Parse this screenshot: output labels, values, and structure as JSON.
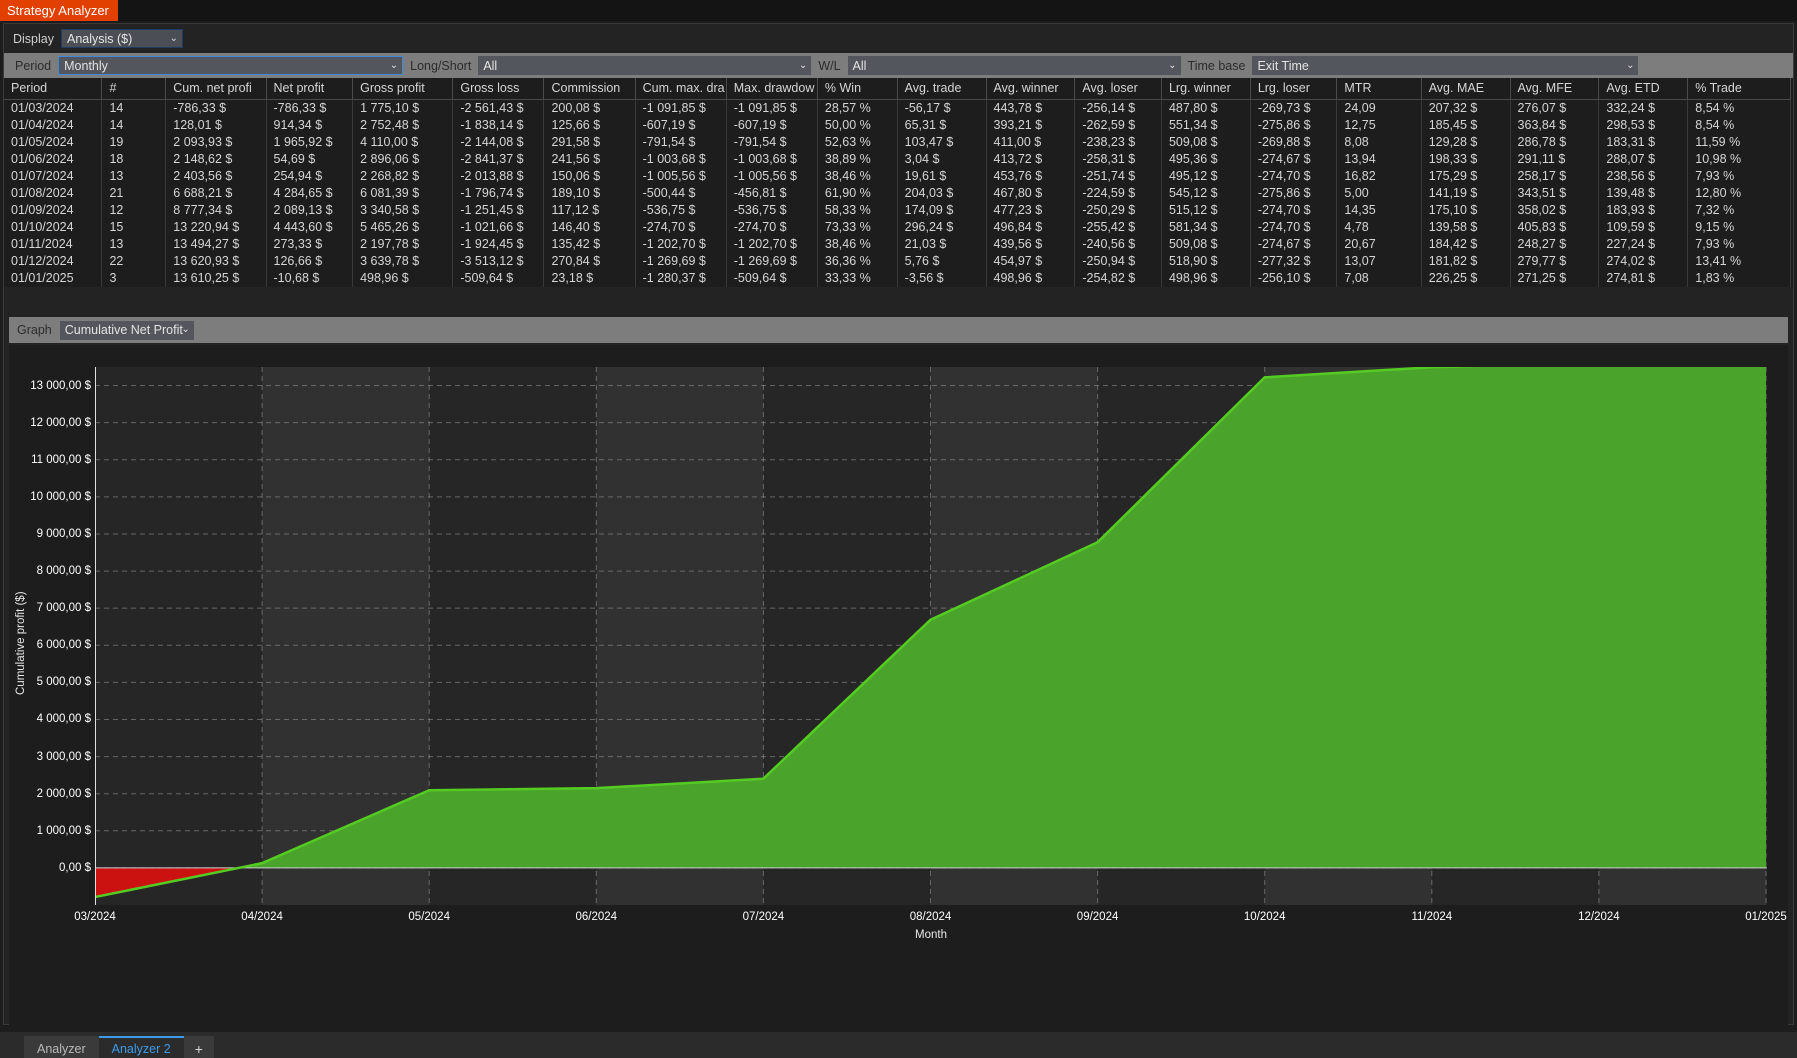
{
  "window": {
    "title": "Strategy Analyzer"
  },
  "toolbar": {
    "display_label": "Display",
    "display_value": "Analysis ($)",
    "period_label": "Period",
    "period_value": "Monthly",
    "longshort_label": "Long/Short",
    "longshort_value": "All",
    "wl_label": "W/L",
    "wl_value": "All",
    "timebase_label": "Time base",
    "timebase_value": "Exit Time",
    "caret": "⌄"
  },
  "graph_bar": {
    "label": "Graph",
    "value": "Cumulative Net Profit",
    "caret": "⌄"
  },
  "table": {
    "columns": [
      "Period",
      "#",
      "Cum. net profi",
      "Net profit",
      "Gross profit",
      "Gross loss",
      "Commission",
      "Cum. max. dra",
      "Max. drawdow",
      "% Win",
      "Avg. trade",
      "Avg. winner",
      "Avg. loser",
      "Lrg. winner",
      "Lrg. loser",
      "MTR",
      "Avg. MAE",
      "Avg. MFE",
      "Avg. ETD",
      "% Trade"
    ],
    "rows": [
      [
        "01/03/2024",
        "14",
        "-786,33 $",
        "-786,33 $",
        "1 775,10 $",
        "-2 561,43 $",
        "200,08 $",
        "-1 091,85 $",
        "-1 091,85 $",
        "28,57 %",
        "-56,17 $",
        "443,78 $",
        "-256,14 $",
        "487,80 $",
        "-269,73 $",
        "24,09",
        "207,32 $",
        "276,07 $",
        "332,24 $",
        "8,54 %"
      ],
      [
        "01/04/2024",
        "14",
        "128,01 $",
        "914,34 $",
        "2 752,48 $",
        "-1 838,14 $",
        "125,66 $",
        "-607,19 $",
        "-607,19 $",
        "50,00 %",
        "65,31 $",
        "393,21 $",
        "-262,59 $",
        "551,34 $",
        "-275,86 $",
        "12,75",
        "185,45 $",
        "363,84 $",
        "298,53 $",
        "8,54 %"
      ],
      [
        "01/05/2024",
        "19",
        "2 093,93 $",
        "1 965,92 $",
        "4 110,00 $",
        "-2 144,08 $",
        "291,58 $",
        "-791,54 $",
        "-791,54 $",
        "52,63 %",
        "103,47 $",
        "411,00 $",
        "-238,23 $",
        "509,08 $",
        "-269,88 $",
        "8,08",
        "129,28 $",
        "286,78 $",
        "183,31 $",
        "11,59 %"
      ],
      [
        "01/06/2024",
        "18",
        "2 148,62 $",
        "54,69 $",
        "2 896,06 $",
        "-2 841,37 $",
        "241,56 $",
        "-1 003,68 $",
        "-1 003,68 $",
        "38,89 %",
        "3,04 $",
        "413,72 $",
        "-258,31 $",
        "495,36 $",
        "-274,67 $",
        "13,94",
        "198,33 $",
        "291,11 $",
        "288,07 $",
        "10,98 %"
      ],
      [
        "01/07/2024",
        "13",
        "2 403,56 $",
        "254,94 $",
        "2 268,82 $",
        "-2 013,88 $",
        "150,06 $",
        "-1 005,56 $",
        "-1 005,56 $",
        "38,46 %",
        "19,61 $",
        "453,76 $",
        "-251,74 $",
        "495,12 $",
        "-274,70 $",
        "16,82",
        "175,29 $",
        "258,17 $",
        "238,56 $",
        "7,93 %"
      ],
      [
        "01/08/2024",
        "21",
        "6 688,21 $",
        "4 284,65 $",
        "6 081,39 $",
        "-1 796,74 $",
        "189,10 $",
        "-500,44 $",
        "-456,81 $",
        "61,90 %",
        "204,03 $",
        "467,80 $",
        "-224,59 $",
        "545,12 $",
        "-275,86 $",
        "5,00",
        "141,19 $",
        "343,51 $",
        "139,48 $",
        "12,80 %"
      ],
      [
        "01/09/2024",
        "12",
        "8 777,34 $",
        "2 089,13 $",
        "3 340,58 $",
        "-1 251,45 $",
        "117,12 $",
        "-536,75 $",
        "-536,75 $",
        "58,33 %",
        "174,09 $",
        "477,23 $",
        "-250,29 $",
        "515,12 $",
        "-274,70 $",
        "14,35",
        "175,10 $",
        "358,02 $",
        "183,93 $",
        "7,32 %"
      ],
      [
        "01/10/2024",
        "15",
        "13 220,94 $",
        "4 443,60 $",
        "5 465,26 $",
        "-1 021,66 $",
        "146,40 $",
        "-274,70 $",
        "-274,70 $",
        "73,33 %",
        "296,24 $",
        "496,84 $",
        "-255,42 $",
        "581,34 $",
        "-274,70 $",
        "4,78",
        "139,58 $",
        "405,83 $",
        "109,59 $",
        "9,15 %"
      ],
      [
        "01/11/2024",
        "13",
        "13 494,27 $",
        "273,33 $",
        "2 197,78 $",
        "-1 924,45 $",
        "135,42 $",
        "-1 202,70 $",
        "-1 202,70 $",
        "38,46 %",
        "21,03 $",
        "439,56 $",
        "-240,56 $",
        "509,08 $",
        "-274,67 $",
        "20,67",
        "184,42 $",
        "248,27 $",
        "227,24 $",
        "7,93 %"
      ],
      [
        "01/12/2024",
        "22",
        "13 620,93 $",
        "126,66 $",
        "3 639,78 $",
        "-3 513,12 $",
        "270,84 $",
        "-1 269,69 $",
        "-1 269,69 $",
        "36,36 %",
        "5,76 $",
        "454,97 $",
        "-250,94 $",
        "518,90 $",
        "-277,32 $",
        "13,07",
        "181,82 $",
        "279,77 $",
        "274,02 $",
        "13,41 %"
      ],
      [
        "01/01/2025",
        "3",
        "13 610,25 $",
        "-10,68 $",
        "498,96 $",
        "-509,64 $",
        "23,18 $",
        "-1 280,37 $",
        "-509,64 $",
        "33,33 %",
        "-3,56 $",
        "498,96 $",
        "-254,82 $",
        "498,96 $",
        "-256,10 $",
        "7,08",
        "226,25 $",
        "271,25 $",
        "274,81 $",
        "1,83 %"
      ]
    ]
  },
  "chart_data": {
    "type": "area",
    "title": "Cumulative Net Profit",
    "xlabel": "Month",
    "ylabel": "Cumulative profit ($)",
    "grid": true,
    "ylim": [
      -1000,
      13500
    ],
    "yticks": [
      "13 000,00 $",
      "12 000,00 $",
      "11 000,00 $",
      "10 000,00 $",
      "9 000,00 $",
      "8 000,00 $",
      "7 000,00 $",
      "6 000,00 $",
      "5 000,00 $",
      "4 000,00 $",
      "3 000,00 $",
      "2 000,00 $",
      "1 000,00 $",
      "0,00 $"
    ],
    "ytick_values": [
      13000,
      12000,
      11000,
      10000,
      9000,
      8000,
      7000,
      6000,
      5000,
      4000,
      3000,
      2000,
      1000,
      0
    ],
    "xticks": [
      "03/2024",
      "04/2024",
      "05/2024",
      "06/2024",
      "07/2024",
      "08/2024",
      "09/2024",
      "10/2024",
      "11/2024",
      "12/2024",
      "01/2025"
    ],
    "categories": [
      "03/2024",
      "04/2024",
      "05/2024",
      "06/2024",
      "07/2024",
      "08/2024",
      "09/2024",
      "10/2024",
      "11/2024",
      "12/2024",
      "01/2025"
    ],
    "values": [
      -786.33,
      128.01,
      2093.93,
      2148.62,
      2403.56,
      6688.21,
      8777.34,
      13220.94,
      13494.27,
      13620.93,
      13610.25
    ],
    "positive_color": "#4aa32a",
    "negative_color": "#cc1111",
    "line_color": "#55cc22",
    "plot_bg": "#262626"
  },
  "tabs": {
    "items": [
      {
        "label": "Analyzer",
        "active": false
      },
      {
        "label": "Analyzer 2",
        "active": true
      }
    ],
    "add_label": "+"
  }
}
